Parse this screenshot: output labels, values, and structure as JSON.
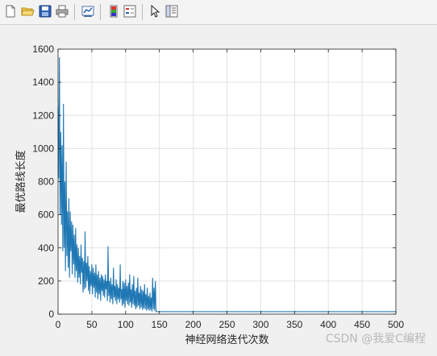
{
  "toolbar": {
    "icons": [
      "new-file-icon",
      "open-folder-icon",
      "save-icon",
      "print-icon",
      "link-plot-icon",
      "colorbar-icon",
      "legend-icon",
      "edit-plot-icon",
      "property-inspector-icon"
    ]
  },
  "chart_data": {
    "type": "line",
    "xlabel": "神经网络迭代次数",
    "ylabel": "最优路线长度",
    "xlim": [
      0,
      500
    ],
    "ylim": [
      0,
      1600
    ],
    "xticks": [
      0,
      50,
      100,
      150,
      200,
      250,
      300,
      350,
      400,
      450,
      500
    ],
    "yticks": [
      0,
      200,
      400,
      600,
      800,
      1000,
      1200,
      1400,
      1600
    ],
    "grid": true,
    "series": [
      {
        "color": "#1f77b4",
        "x": [
          0,
          1,
          2,
          3,
          4,
          5,
          6,
          7,
          8,
          9,
          10,
          11,
          12,
          13,
          14,
          15,
          16,
          17,
          18,
          19,
          20,
          21,
          22,
          23,
          24,
          25,
          26,
          27,
          28,
          29,
          30,
          31,
          32,
          33,
          34,
          35,
          36,
          37,
          38,
          39,
          40,
          41,
          42,
          43,
          44,
          45,
          46,
          47,
          48,
          49,
          50,
          51,
          52,
          53,
          54,
          55,
          56,
          57,
          58,
          59,
          60,
          61,
          62,
          63,
          64,
          65,
          66,
          67,
          68,
          69,
          70,
          71,
          72,
          73,
          74,
          75,
          76,
          77,
          78,
          79,
          80,
          81,
          82,
          83,
          84,
          85,
          86,
          87,
          88,
          89,
          90,
          91,
          92,
          93,
          94,
          95,
          96,
          97,
          98,
          99,
          100,
          101,
          102,
          103,
          104,
          105,
          106,
          107,
          108,
          109,
          110,
          111,
          112,
          113,
          114,
          115,
          116,
          117,
          118,
          119,
          120,
          121,
          122,
          123,
          124,
          125,
          126,
          127,
          128,
          129,
          130,
          131,
          132,
          133,
          134,
          135,
          136,
          137,
          138,
          139,
          140,
          141,
          142,
          143,
          144,
          145,
          146,
          147,
          148,
          149,
          150,
          500
        ],
        "values": [
          1250,
          820,
          1550,
          600,
          1100,
          540,
          1020,
          380,
          1270,
          400,
          800,
          260,
          920,
          350,
          620,
          280,
          700,
          220,
          620,
          380,
          560,
          240,
          540,
          300,
          480,
          220,
          520,
          260,
          420,
          190,
          400,
          220,
          350,
          180,
          420,
          250,
          340,
          130,
          320,
          150,
          500,
          160,
          310,
          200,
          350,
          140,
          290,
          120,
          260,
          170,
          300,
          120,
          280,
          160,
          250,
          100,
          300,
          130,
          240,
          90,
          260,
          120,
          220,
          80,
          240,
          140,
          230,
          110,
          210,
          100,
          240,
          150,
          200,
          80,
          410,
          110,
          200,
          70,
          220,
          90,
          180,
          60,
          280,
          100,
          170,
          80,
          210,
          60,
          180,
          90,
          160,
          70,
          300,
          90,
          150,
          50,
          200,
          60,
          190,
          40,
          210,
          80,
          170,
          60,
          190,
          50,
          240,
          70,
          150,
          40,
          180,
          60,
          230,
          50,
          140,
          30,
          160,
          40,
          220,
          50,
          130,
          30,
          170,
          40,
          150,
          25,
          140,
          35,
          180,
          30,
          120,
          20,
          160,
          30,
          110,
          20,
          130,
          25,
          100,
          15,
          220,
          30,
          160,
          20,
          200,
          15,
          15,
          15,
          15,
          15,
          15,
          15
        ]
      }
    ]
  },
  "watermark": "CSDN @我爱C编程"
}
